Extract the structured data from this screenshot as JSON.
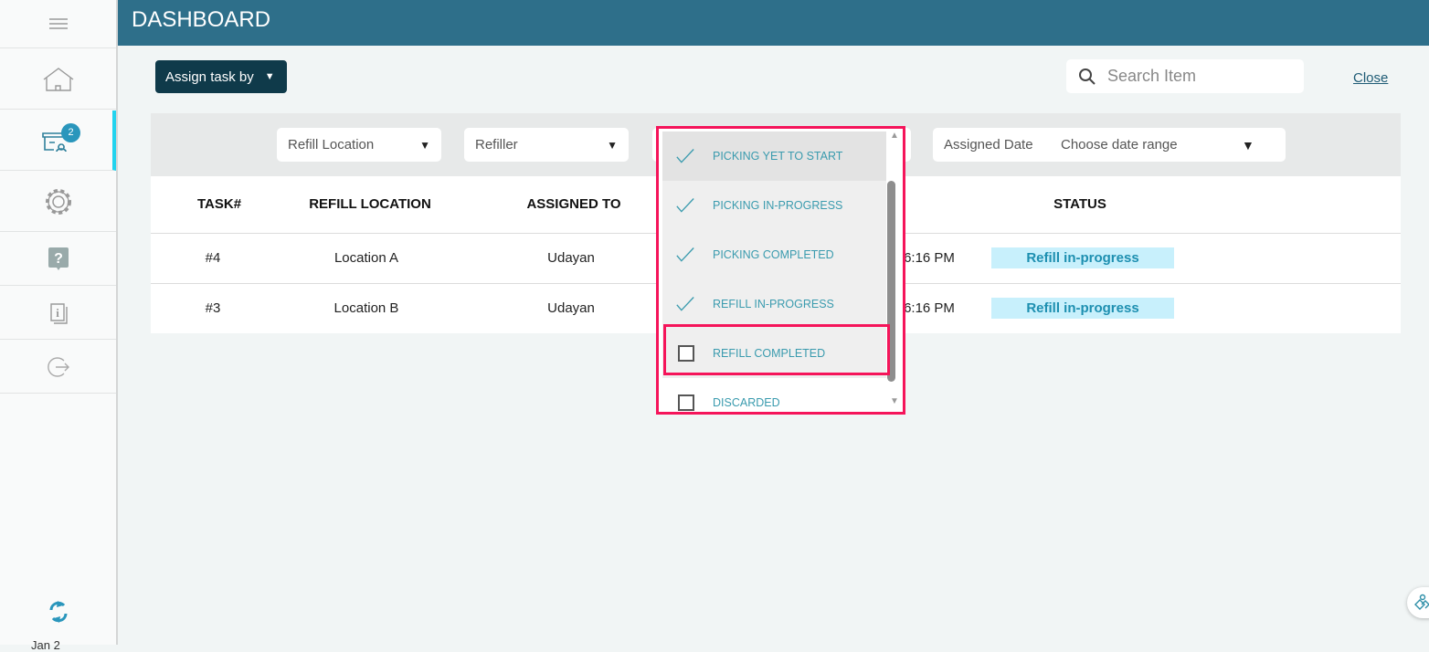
{
  "header": {
    "title": "DASHBOARD"
  },
  "sidebar": {
    "items": [
      {
        "icon": "menu-icon"
      },
      {
        "icon": "home-icon"
      },
      {
        "icon": "tasks-icon",
        "badge": "2",
        "active": true
      },
      {
        "icon": "gear-icon"
      },
      {
        "icon": "help-icon"
      },
      {
        "icon": "info-icon"
      },
      {
        "icon": "logout-icon"
      }
    ],
    "sync_icon": "sync-icon",
    "footer_text": "Jan 2"
  },
  "toolbar": {
    "assign_label": "Assign task by",
    "search_placeholder": "Search Item",
    "close_label": "Close"
  },
  "filters": {
    "refill_location": "Refill Location",
    "refiller": "Refiller",
    "assigned_date_label": "Assigned Date",
    "date_range": "Choose date range"
  },
  "table": {
    "headers": [
      "TASK#",
      "REFILL LOCATION",
      "ASSIGNED TO",
      "STATUS"
    ],
    "rows": [
      {
        "task": "#4",
        "location": "Location A",
        "assigned_to": "Udayan",
        "time": "6:16 PM",
        "status": "Refill in-progress"
      },
      {
        "task": "#3",
        "location": "Location B",
        "assigned_to": "Udayan",
        "time": "6:16 PM",
        "status": "Refill in-progress"
      }
    ]
  },
  "status_dropdown": {
    "options": [
      {
        "label": "PICKING YET TO START",
        "checked": true
      },
      {
        "label": "PICKING IN-PROGRESS",
        "checked": true
      },
      {
        "label": "PICKING COMPLETED",
        "checked": true
      },
      {
        "label": "REFILL IN-PROGRESS",
        "checked": true
      },
      {
        "label": "REFILL COMPLETED",
        "checked": false
      },
      {
        "label": "DISCARDED",
        "checked": false
      }
    ]
  },
  "colors": {
    "header": "#2e6f8a",
    "highlight": "#f5145a",
    "accent": "#3a9bae",
    "badge_bg": "#c8f0fc"
  }
}
